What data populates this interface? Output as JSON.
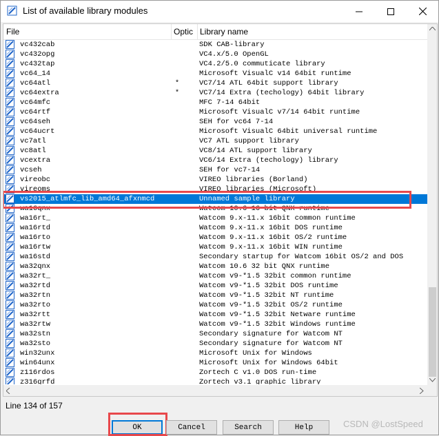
{
  "window": {
    "title": "List of available library modules"
  },
  "columns": {
    "file": "File",
    "optional": "Optic",
    "library_name": "Library name"
  },
  "rows": [
    {
      "file": "vc432cab",
      "opt": "",
      "lib": "SDK CAB-library"
    },
    {
      "file": "vc432opg",
      "opt": "",
      "lib": "VC4.x/5.0 OpenGL"
    },
    {
      "file": "vc432tap",
      "opt": "",
      "lib": "VC4.2/5.0 commuticate library"
    },
    {
      "file": "vc64_14",
      "opt": "",
      "lib": "Microsoft VisualC v14 64bit runtime"
    },
    {
      "file": "vc64atl",
      "opt": "*",
      "lib": "VC7/14 ATL 64bit support library"
    },
    {
      "file": "vc64extra",
      "opt": "*",
      "lib": "VC7/14 Extra (techology) 64bit library"
    },
    {
      "file": "vc64mfc",
      "opt": "",
      "lib": "MFC 7-14 64bit"
    },
    {
      "file": "vc64rtf",
      "opt": "",
      "lib": "Microsoft VisualC v7/14 64bit runtime"
    },
    {
      "file": "vc64seh",
      "opt": "",
      "lib": "SEH for vc64 7-14"
    },
    {
      "file": "vc64ucrt",
      "opt": "",
      "lib": "Microsoft VisualC 64bit universal runtime"
    },
    {
      "file": "vc7atl",
      "opt": "",
      "lib": "VC7 ATL support library"
    },
    {
      "file": "vc8atl",
      "opt": "",
      "lib": "VC8/14 ATL support library"
    },
    {
      "file": "vcextra",
      "opt": "",
      "lib": "VC6/14 Extra (techology) library"
    },
    {
      "file": "vcseh",
      "opt": "",
      "lib": "SEH for vc7-14"
    },
    {
      "file": "vireobc",
      "opt": "",
      "lib": "VIREO libraries (Borland)"
    },
    {
      "file": "vireoms",
      "opt": "",
      "lib": "VIREO libraries (Microsoft)"
    },
    {
      "file": "vs2015_atlmfc_lib_amd64_afxnmcd",
      "opt": "",
      "lib": "Unnamed sample library",
      "selected": true
    },
    {
      "file": "wa16qnx",
      "opt": "",
      "lib": "Watcom 10.6 16 bit QNX runtime"
    },
    {
      "file": "wa16rt_",
      "opt": "",
      "lib": "Watcom 9.x-11.x 16bit common runtime"
    },
    {
      "file": "wa16rtd",
      "opt": "",
      "lib": "Watcom 9.x-11.x 16bit DOS runtime"
    },
    {
      "file": "wa16rto",
      "opt": "",
      "lib": "Watcom 9.x-11.x 16bit OS/2 runtime"
    },
    {
      "file": "wa16rtw",
      "opt": "",
      "lib": "Watcom 9.x-11.x 16bit WIN runtime"
    },
    {
      "file": "wa16std",
      "opt": "",
      "lib": "Secondary startup for Watcom 16bit OS/2 and DOS"
    },
    {
      "file": "wa32qnx",
      "opt": "",
      "lib": "Watcom 10.6 32 bit QNX runtime"
    },
    {
      "file": "wa32rt_",
      "opt": "",
      "lib": "Watcom v9-*1.5  32bit common runtime"
    },
    {
      "file": "wa32rtd",
      "opt": "",
      "lib": "Watcom v9-*1.5  32bit DOS runtime"
    },
    {
      "file": "wa32rtn",
      "opt": "",
      "lib": "Watcom v9-*1.5  32bit NT runtime"
    },
    {
      "file": "wa32rto",
      "opt": "",
      "lib": "Watcom v9-*1.5  32bit OS/2 runtime"
    },
    {
      "file": "wa32rtt",
      "opt": "",
      "lib": "Watcom v9-*1.5  32bit Netware runtime"
    },
    {
      "file": "wa32rtw",
      "opt": "",
      "lib": "Watcom v9-*1.5  32bit Windows runtime"
    },
    {
      "file": "wa32stn",
      "opt": "",
      "lib": "Secondary signature for Watcom NT"
    },
    {
      "file": "wa32sto",
      "opt": "",
      "lib": "Secondary signature for Watcom NT"
    },
    {
      "file": "win32unx",
      "opt": "",
      "lib": "Microsoft Unix for Windows"
    },
    {
      "file": "win64unx",
      "opt": "",
      "lib": "Microsoft Unix for Windows 64bit"
    },
    {
      "file": "z116rdos",
      "opt": "",
      "lib": "Zortech C v1.0 DOS run-time"
    },
    {
      "file": "z316grfd",
      "opt": "",
      "lib": "Zortech v3.1 graphic library"
    }
  ],
  "status": {
    "line_text": "Line 134 of 157"
  },
  "buttons": {
    "ok": "OK",
    "cancel": "Cancel",
    "search": "Search",
    "help": "Help"
  },
  "watermark": "CSDN @LostSpeed",
  "colors": {
    "selection": "#0078d7",
    "annotation": "#e8484b",
    "icon_blue": "#1e64c8"
  }
}
